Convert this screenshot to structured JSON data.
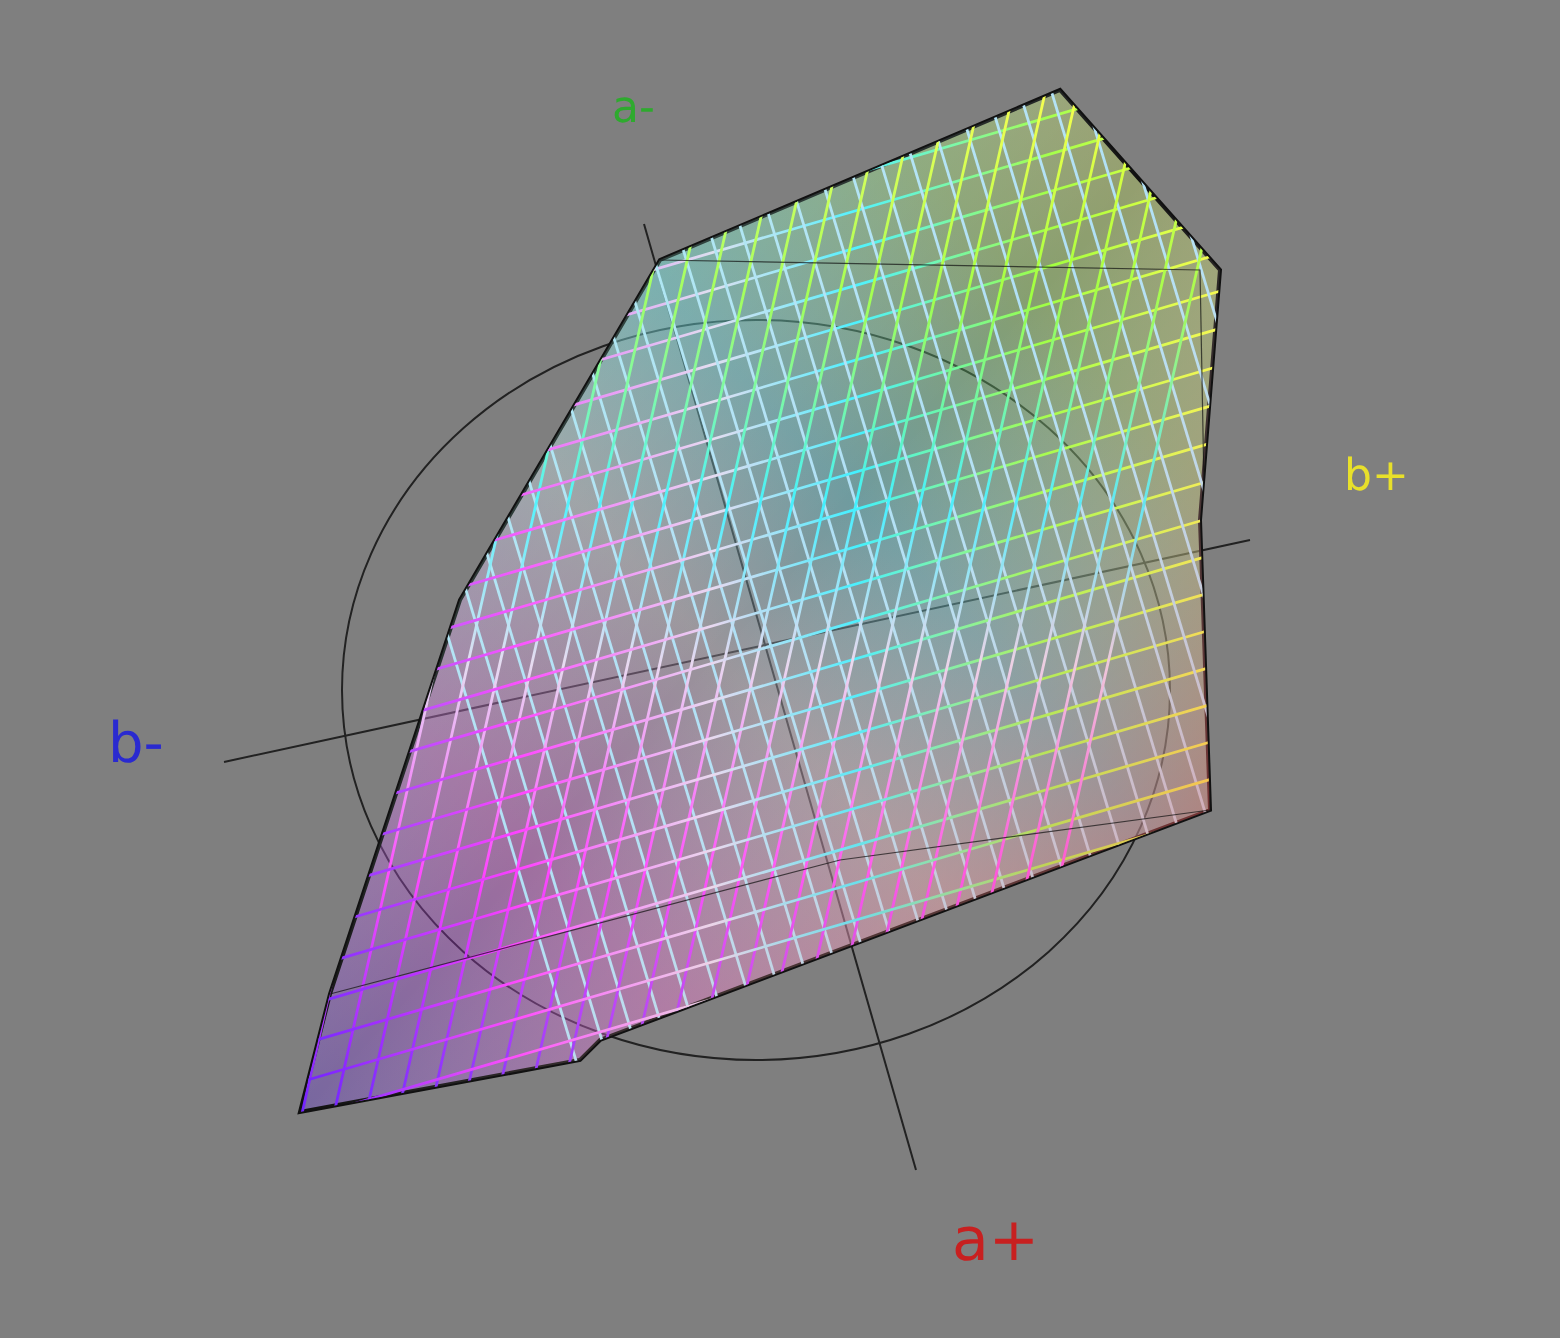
{
  "axis_labels": [
    {
      "text": "a-",
      "color": "#2eaa2e"
    },
    {
      "text": "b+",
      "color": "#e8e02a"
    },
    {
      "text": "b-",
      "color": "#2a2ad0"
    },
    {
      "text": "a+",
      "color": "#c82020"
    }
  ]
}
